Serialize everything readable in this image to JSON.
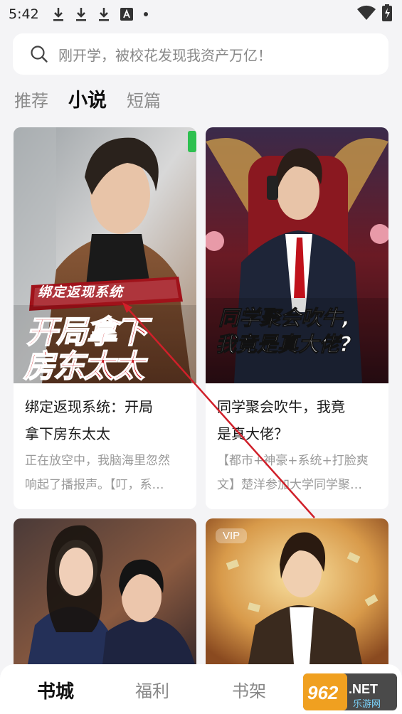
{
  "status_bar": {
    "time": "5:42",
    "icons": [
      "download-icon",
      "download-icon",
      "download-icon",
      "font-icon",
      "dot-icon"
    ],
    "right_icons": [
      "wifi-icon",
      "battery-charging-icon"
    ]
  },
  "search": {
    "placeholder": "刚开学，被校花发现我资产万亿！"
  },
  "tabs": [
    {
      "label": "推荐",
      "active": false
    },
    {
      "label": "小说",
      "active": true
    },
    {
      "label": "短篇",
      "active": false
    }
  ],
  "books": [
    {
      "cover_badge": "绑定返现系统",
      "cover_title_line1": "开局拿下",
      "cover_title_line2": "房东太太",
      "title": "绑定返现系统：开局拿下房东太太",
      "title_line1": "绑定返现系统：开局",
      "title_line2": "拿下房东太太",
      "desc_line1": "正在放空中，我脑海里忽然",
      "desc_line2": "响起了播报声。【叮，系…"
    },
    {
      "cover_title_line1": "同学聚会吹牛,",
      "cover_title_line2": "我竟是真大佬?",
      "title_line1": "同学聚会吹牛，我竟",
      "title_line2": "是真大佬？",
      "desc_line1": "【都市+神豪+系统+打脸爽",
      "desc_line2": "文】楚洋参加大学同学聚…"
    },
    {
      "cover_badge": ""
    },
    {
      "cover_badge": "VIP"
    }
  ],
  "bottom_nav": [
    {
      "label": "书城",
      "active": true
    },
    {
      "label": "福利",
      "active": false
    },
    {
      "label": "书架",
      "active": false
    }
  ],
  "watermark": {
    "text": "962.NET",
    "subtext": "乐游网"
  },
  "colors": {
    "accent_red": "#d0202a",
    "background": "#f4f4f6"
  }
}
